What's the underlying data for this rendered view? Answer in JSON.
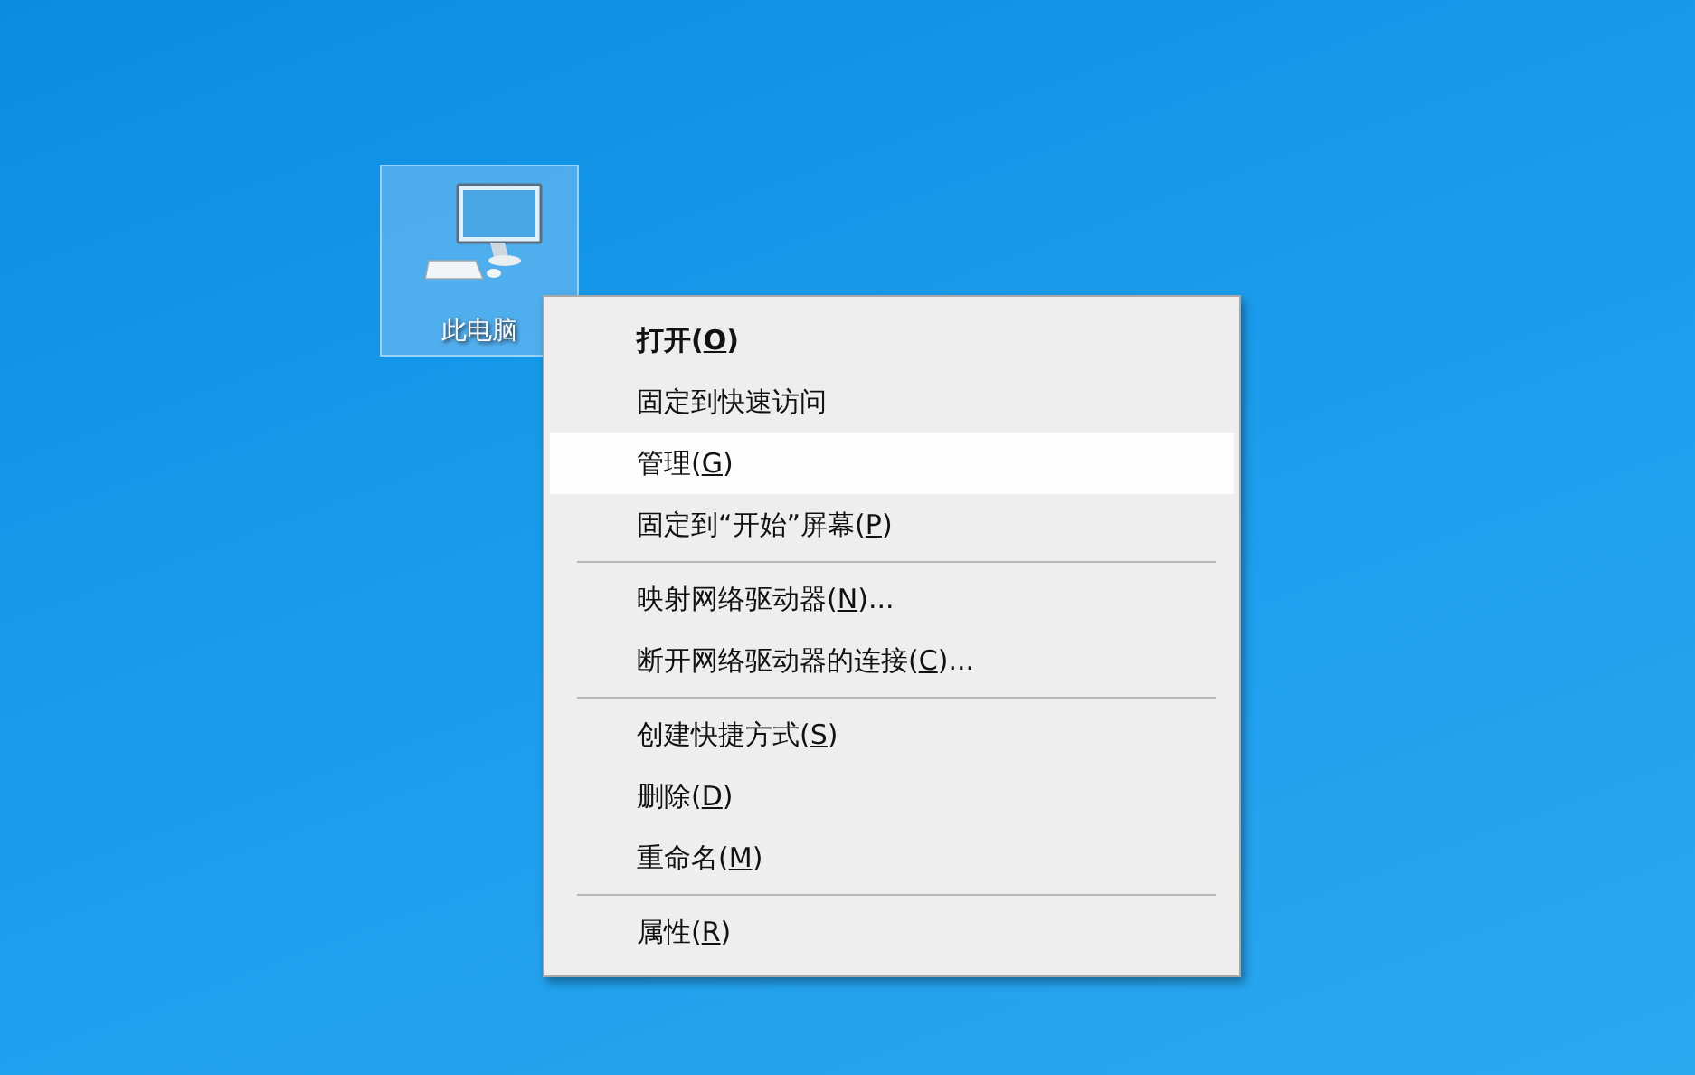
{
  "desktop_icon": {
    "label": "此电脑",
    "selected": true
  },
  "context_menu": {
    "sections": [
      [
        {
          "before": "打开(",
          "key": "O",
          "after": ")",
          "default": true,
          "selected": false
        },
        {
          "before": "固定到快速访问",
          "default": false,
          "selected": false
        },
        {
          "before": "管理(",
          "key": "G",
          "after": ")",
          "default": false,
          "selected": true
        },
        {
          "before": "固定到“开始”屏幕(",
          "key": "P",
          "after": ")",
          "default": false,
          "selected": false
        }
      ],
      [
        {
          "before": "映射网络驱动器(",
          "key": "N",
          "after": ")...",
          "default": false,
          "selected": false
        },
        {
          "before": "断开网络驱动器的连接(",
          "key": "C",
          "after": ")...",
          "default": false,
          "selected": false
        }
      ],
      [
        {
          "before": "创建快捷方式(",
          "key": "S",
          "after": ")",
          "default": false,
          "selected": false
        },
        {
          "before": "删除(",
          "key": "D",
          "after": ")",
          "default": false,
          "selected": false
        },
        {
          "before": "重命名(",
          "key": "M",
          "after": ")",
          "default": false,
          "selected": false
        }
      ],
      [
        {
          "before": "属性(",
          "key": "R",
          "after": ")",
          "default": false,
          "selected": false
        }
      ]
    ]
  }
}
